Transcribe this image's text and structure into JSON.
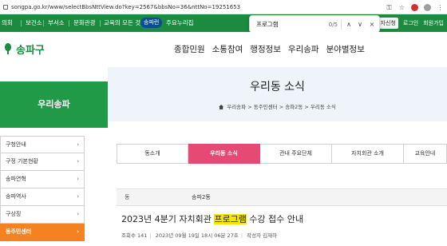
{
  "browser": {
    "url": "songpa.go.kr/www/selectBbsNttView.do?key=2567&bbsNo=36&nttNo=19251653",
    "icons": [
      "key-icon",
      "star-icon",
      "extension-icon",
      "profile-icon",
      "menu-icon"
    ]
  },
  "bookmarks": {
    "items": [
      "의회",
      "보건소",
      "부서소",
      "문화관광",
      "교육의 모든 것"
    ],
    "badge": "송파런",
    "more": "주요누리집",
    "right": [
      "문자신청",
      "로그인",
      "회원가입"
    ]
  },
  "findbar": {
    "query": "프로그램",
    "count": "0/5",
    "up": "∧",
    "down": "∨",
    "close": "×"
  },
  "site": {
    "logo_text": "송파구",
    "gnb": [
      "종합민원",
      "소통참여",
      "행정정보",
      "우리송파",
      "분야별정보"
    ]
  },
  "sidebar": {
    "title": "우리송파",
    "items": [
      {
        "label": "구청안내",
        "active": false
      },
      {
        "label": "구정 기본현황",
        "active": false
      },
      {
        "label": "송파연혁",
        "active": false
      },
      {
        "label": "송파역사",
        "active": false
      },
      {
        "label": "구상징",
        "active": false
      },
      {
        "label": "동주민센터",
        "active": true
      }
    ]
  },
  "subvisual": {
    "title": "우리동 소식",
    "breadcrumb": [
      "우리송파",
      "동주민센터",
      "송파2동",
      "우리동 소식"
    ]
  },
  "tabs": [
    {
      "label": "동소개",
      "active": false
    },
    {
      "label": "우리동 소식",
      "active": true
    },
    {
      "label": "관내 주요단체",
      "active": false
    },
    {
      "label": "자치회관 소개",
      "active": false
    },
    {
      "label": "교육안내",
      "active": false
    }
  ],
  "board": {
    "dong_label": "동",
    "dong_value": "송파2동",
    "title_before": "2023년 4분기 자치회관 ",
    "title_highlight": "프로그램",
    "title_after": " 수강 접수 안내",
    "views": "조회수 141",
    "date": "2023년 09월 19일 18시 06분 27초",
    "author": "작성자 김재하"
  },
  "colors": {
    "green": "#1c8a3f",
    "side_green": "#209a47",
    "orange": "#f58220",
    "pink": "#e64973",
    "highlight": "#f6e600"
  }
}
